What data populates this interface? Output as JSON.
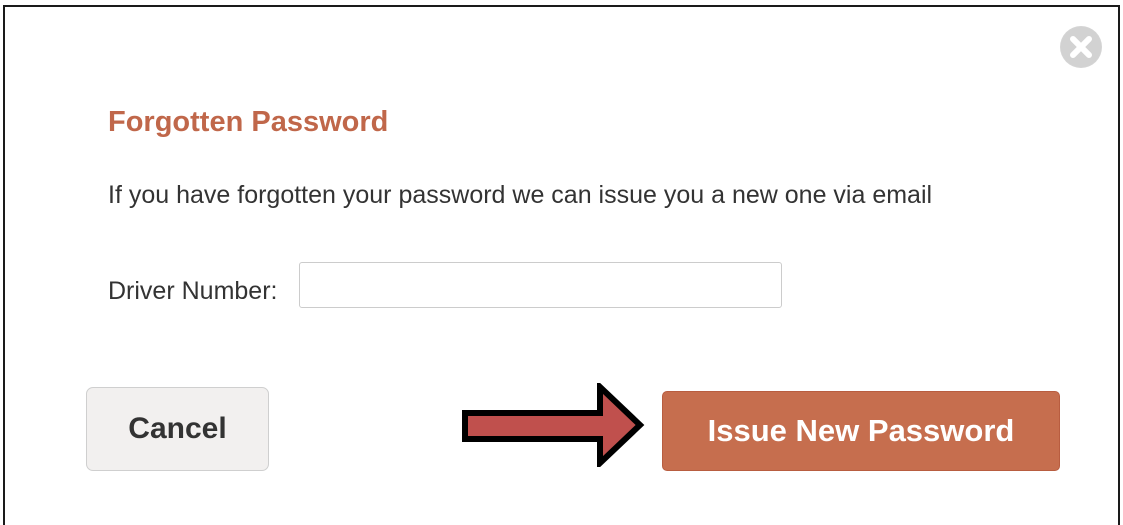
{
  "dialog": {
    "title": "Forgotten Password",
    "description": "If you have forgotten your password we can issue you a new one via email",
    "close_icon": "close-circle-icon"
  },
  "form": {
    "driver_number_label": "Driver Number:",
    "driver_number_value": "",
    "driver_number_placeholder": ""
  },
  "actions": {
    "cancel_label": "Cancel",
    "issue_label": "Issue New Password"
  },
  "annotation": {
    "arrow_icon": "right-arrow-icon",
    "arrow_color": "#c0504d"
  },
  "colors": {
    "accent": "#c66e4e",
    "title": "#c0674a",
    "text": "#333333"
  }
}
